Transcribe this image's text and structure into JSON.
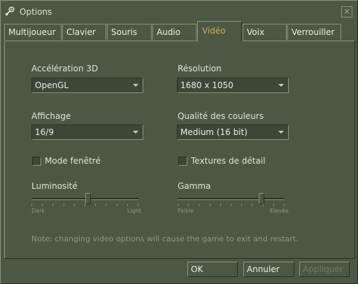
{
  "window": {
    "title": "Options",
    "close_label": "×"
  },
  "tabs": [
    {
      "label": "Multijoueur"
    },
    {
      "label": "Clavier"
    },
    {
      "label": "Souris"
    },
    {
      "label": "Audio"
    },
    {
      "label": "Vidéo"
    },
    {
      "label": "Voix"
    },
    {
      "label": "Verrouiller"
    }
  ],
  "video": {
    "accel_label": "Accélération 3D",
    "accel_value": "OpenGL",
    "resolution_label": "Résolution",
    "resolution_value": "1680 x 1050",
    "display_label": "Affichage",
    "display_value": "16/9",
    "color_label": "Qualité des couleurs",
    "color_value": "Medium (16 bit)",
    "windowed_label": "Mode fenêtré",
    "windowed_checked": false,
    "detail_label": "Textures de détail",
    "detail_checked": false,
    "brightness_label": "Luminosité",
    "brightness_min": "Dark",
    "brightness_max": "Light",
    "brightness_value": 0.53,
    "gamma_label": "Gamma",
    "gamma_min": "Faible",
    "gamma_max": "Elevée",
    "gamma_value": 0.8,
    "note": "Note: changing video options will cause the game to exit and restart."
  },
  "buttons": {
    "ok": "OK",
    "cancel": "Annuler",
    "apply": "Appliquer"
  },
  "colors": {
    "background": "#4c5844",
    "active_tab_text": "#c4b54a",
    "text": "#dfe5da"
  }
}
